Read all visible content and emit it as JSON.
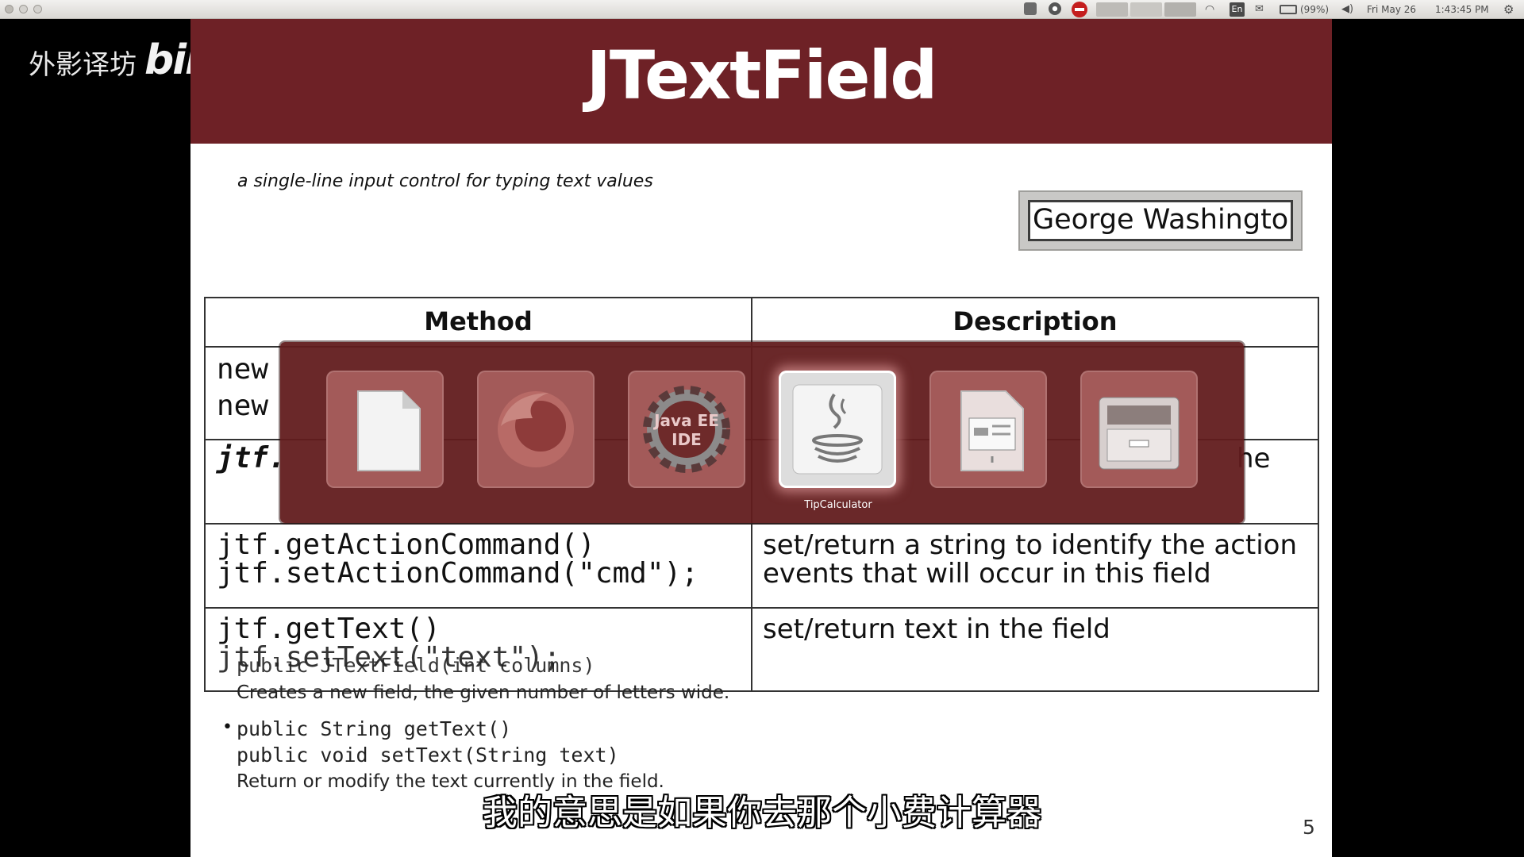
{
  "topbar": {
    "keyboard_layout": "En",
    "battery": "(99%)",
    "datetime": "Fri May 26",
    "time": "1:43:45 PM",
    "icons": [
      "record-icon",
      "chrome-icon",
      "stop-icon",
      "window-thumbs",
      "wifi-icon",
      "keyboard-icon",
      "mail-icon",
      "battery-icon",
      "volume-icon",
      "settings-gear-icon"
    ]
  },
  "slide": {
    "title": "JTextField",
    "subtitle": "a single-line input control for typing text values",
    "demo_field_value": "George Washington",
    "table": {
      "headers": [
        "Method",
        "Description"
      ],
      "rows": [
        {
          "method": [
            "new",
            "new"
          ],
          "description": [
            ""
          ]
        },
        {
          "method": [
            "jtf."
          ],
          "description": [
            "he"
          ]
        },
        {
          "method": [
            "jtf.getActionCommand()",
            "jtf.setActionCommand(\"cmd\");"
          ],
          "description": [
            "set/return a string to identify the action",
            "events that will occur in this field"
          ]
        },
        {
          "method": [
            "jtf.getText()",
            "jtf.setText(\"text\");"
          ],
          "description": [
            "set/return text in the field"
          ]
        }
      ]
    },
    "ghost_lines": {
      "constructor_sig": "public JTextField(int columns)",
      "constructor_desc": "Creates a new field, the given number of letters wide."
    },
    "bullets": {
      "line1": "public String getText()",
      "line2": "public void setText(String text)",
      "line3": "Return or modify the text currently in the field."
    },
    "page_number": "5"
  },
  "switcher": {
    "apps": [
      {
        "name": "libreoffice-writer",
        "icon": "document-icon"
      },
      {
        "name": "firefox",
        "icon": "firefox-icon"
      },
      {
        "name": "java-ee-ide",
        "icon": "gear-icon",
        "icon_text": "Java EE IDE"
      },
      {
        "name": "tipcalculator",
        "icon": "java-cup-icon",
        "selected": true
      },
      {
        "name": "libreoffice-impress",
        "icon": "presentation-icon"
      },
      {
        "name": "file-manager",
        "icon": "file-cabinet-icon"
      }
    ],
    "selected_label": "TipCalculator"
  },
  "watermark": {
    "text": "外影译坊",
    "logo": "bilibili"
  },
  "caption": "我的意思是如果你去那个小费计算器"
}
